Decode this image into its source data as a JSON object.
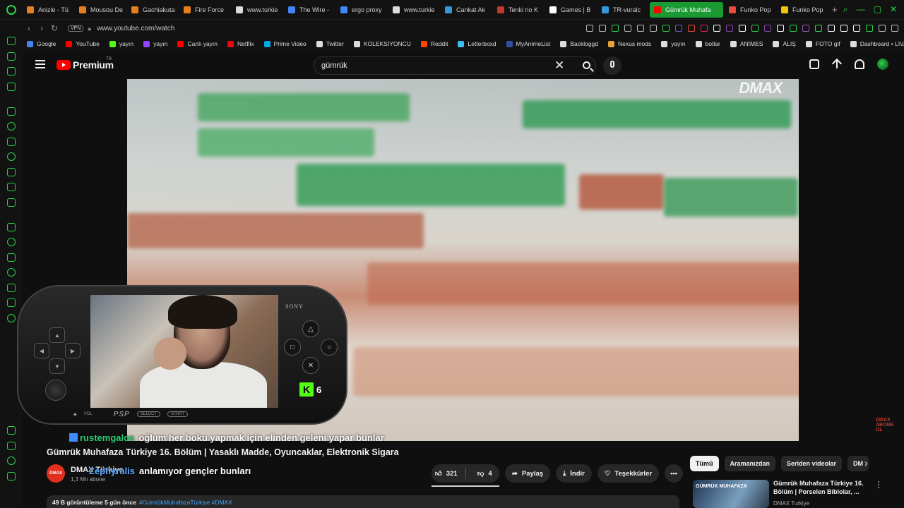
{
  "browser": {
    "tabs": [
      {
        "label": "Anizle - Tü",
        "color": "#e67e22"
      },
      {
        "label": "Mousou De",
        "color": "#e67e22"
      },
      {
        "label": "Gachiakuta",
        "color": "#e67e22"
      },
      {
        "label": "Fire Force",
        "color": "#e67e22"
      },
      {
        "label": "www.turkie",
        "color": "#dcdcdc"
      },
      {
        "label": "The Wire -",
        "color": "#4285f4"
      },
      {
        "label": "ergo proxy",
        "color": "#4285f4"
      },
      {
        "label": "www.turkie",
        "color": "#dcdcdc"
      },
      {
        "label": "Cankat Ak",
        "color": "#3498db"
      },
      {
        "label": "Tenki no K",
        "color": "#c0392b"
      },
      {
        "label": "Games | B",
        "color": "#ffffff"
      },
      {
        "label": "TR-vuralc",
        "color": "#3498db"
      },
      {
        "label": "Gümrük Muhafa",
        "color": "#ff0000",
        "active": true
      },
      {
        "label": "Funko Pop",
        "color": "#e74c3c"
      },
      {
        "label": "Funko Pop",
        "color": "#f1c40f"
      }
    ],
    "url": "www.youtube.com/watch",
    "vpn_label": "VPN",
    "bookmarks": [
      {
        "label": "Google",
        "color": "#4285f4"
      },
      {
        "label": "YouTube",
        "color": "#ff0000"
      },
      {
        "label": "yayın",
        "color": "#53fc18"
      },
      {
        "label": "yayın",
        "color": "#9146ff"
      },
      {
        "label": "Canlı yayın",
        "color": "#ff0000"
      },
      {
        "label": "Netflix",
        "color": "#e50914"
      },
      {
        "label": "Prime Video",
        "color": "#00a8e1"
      },
      {
        "label": "Twitter",
        "color": "#dcdcdc"
      },
      {
        "label": "KOLEKSİYONCU",
        "color": "#dcdcdc"
      },
      {
        "label": "Reddit",
        "color": "#ff4500"
      },
      {
        "label": "Letterboxd",
        "color": "#40bcf4"
      },
      {
        "label": "MyAnimeList",
        "color": "#2e51a2"
      },
      {
        "label": "Backloggd",
        "color": "#dcdcdc"
      },
      {
        "label": "Nexus mods",
        "color": "#e8a23a"
      },
      {
        "label": "yayın",
        "color": "#dcdcdc"
      },
      {
        "label": "botlar",
        "color": "#dcdcdc"
      },
      {
        "label": "ANİMES",
        "color": "#dcdcdc"
      },
      {
        "label": "ALIŞ",
        "color": "#dcdcdc"
      },
      {
        "label": "FOTO gif",
        "color": "#dcdcdc"
      },
      {
        "label": "Dashboard • LIVAD",
        "color": "#dcdcdc"
      }
    ],
    "accent": "#2bd24a"
  },
  "youtube": {
    "brand": "Premium",
    "country": "TR",
    "search_query": "gümrük",
    "video": {
      "watermark": "DMAX",
      "corner_logo": "DMAX ABONE OL",
      "title": "Gümrük Muhafaza Türkiye 16. Bölüm | Yasaklı Madde, Oyuncaklar, Elektronik Sigara"
    },
    "channel": {
      "name": "DMAX Türkiye",
      "avatar_text": "DMAX",
      "subscribers": "1,3 Mn abone"
    },
    "actions": {
      "likes": "321",
      "dislikes": "4",
      "share": "Paylaş",
      "download": "İndir",
      "thanks": "Teşekkürler"
    },
    "description": {
      "meta": "49 B görüntüleme  5 gün önce",
      "tags": "#GümrükMuhafazaTürkiye #DMAX"
    },
    "chips": [
      "Tümü",
      "Aramanızdan",
      "Seriden videolar",
      "DM"
    ],
    "recommendation": {
      "thumb_text": "GÜMRÜK MUHAFAZA",
      "title": "Gümrük Muhafaza Türkiye 16. Bölüm | Porselen Biblolar, ...",
      "channel": "DMAX Turkiye"
    }
  },
  "overlay": {
    "psp_brand": "SONY",
    "psp_logo": "PSP",
    "psp_vol": "VOL",
    "psp_select": "SELECT",
    "psp_start": "START",
    "kick_letter": "K",
    "kick_viewers": "6",
    "chat": [
      {
        "user": "rustemgalos",
        "message": "oğlum her boku yapmak için elinden geleni yapar bunlar"
      },
      {
        "user": "Zephyralis",
        "message": "anlamıyor gençler bunları"
      }
    ]
  }
}
